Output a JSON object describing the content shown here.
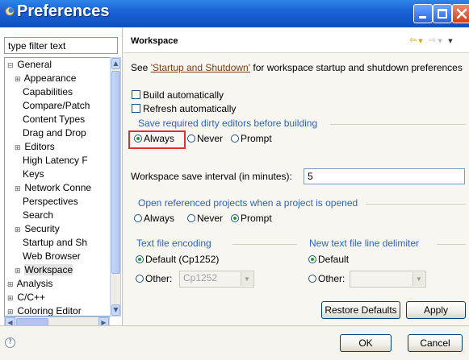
{
  "window": {
    "title": "Preferences"
  },
  "filter": {
    "placeholder": "type filter text"
  },
  "tree": {
    "items": [
      {
        "label": "General",
        "expander": "⊟"
      },
      {
        "label": "Appearance",
        "expander": "⊞"
      },
      {
        "label": "Capabilities",
        "expander": ""
      },
      {
        "label": "Compare/Patch",
        "expander": ""
      },
      {
        "label": "Content Types",
        "expander": ""
      },
      {
        "label": "Drag and Drop",
        "expander": ""
      },
      {
        "label": "Editors",
        "expander": "⊞"
      },
      {
        "label": "High Latency F",
        "expander": ""
      },
      {
        "label": "Keys",
        "expander": ""
      },
      {
        "label": "Network Conne",
        "expander": "⊞"
      },
      {
        "label": "Perspectives",
        "expander": ""
      },
      {
        "label": "Search",
        "expander": ""
      },
      {
        "label": "Security",
        "expander": "⊞"
      },
      {
        "label": "Startup and Sh",
        "expander": ""
      },
      {
        "label": "Web Browser",
        "expander": ""
      },
      {
        "label": "Workspace",
        "expander": "⊞"
      },
      {
        "label": "Analysis",
        "expander": "⊞"
      },
      {
        "label": "C/C++",
        "expander": "⊞"
      },
      {
        "label": "Coloring Editor",
        "expander": "⊞"
      }
    ]
  },
  "page": {
    "title": "Workspace",
    "intro_prefix": "See ",
    "intro_link": "'Startup and Shutdown'",
    "intro_suffix": " for workspace startup and shutdown preferences",
    "build_auto": "Build automatically",
    "refresh_auto": "Refresh automatically",
    "save_dirty_label": "Save required dirty editors before building",
    "save_dirty_options": [
      "Always",
      "Never",
      "Prompt"
    ],
    "save_dirty_selected": "Always",
    "save_interval_label": "Workspace save interval (in minutes):",
    "save_interval_value": "5",
    "open_ref_label": "Open referenced projects when a project is opened",
    "open_ref_options": [
      "Always",
      "Never",
      "Prompt"
    ],
    "open_ref_selected": "Prompt",
    "encoding": {
      "group": "Text file encoding",
      "default": "Default (Cp1252)",
      "other": "Other:",
      "other_value": "Cp1252",
      "selected": "default"
    },
    "delimiter": {
      "group": "New text file line delimiter",
      "default": "Default",
      "other": "Other:",
      "selected": "default"
    },
    "restore_defaults": "Restore Defaults",
    "apply": "Apply"
  },
  "footer": {
    "ok": "OK",
    "cancel": "Cancel"
  },
  "colors": {
    "title_bar": "#1b63d6",
    "group_title": "#2a62c9",
    "link": "#7b3b14",
    "highlight": "#e03131"
  }
}
